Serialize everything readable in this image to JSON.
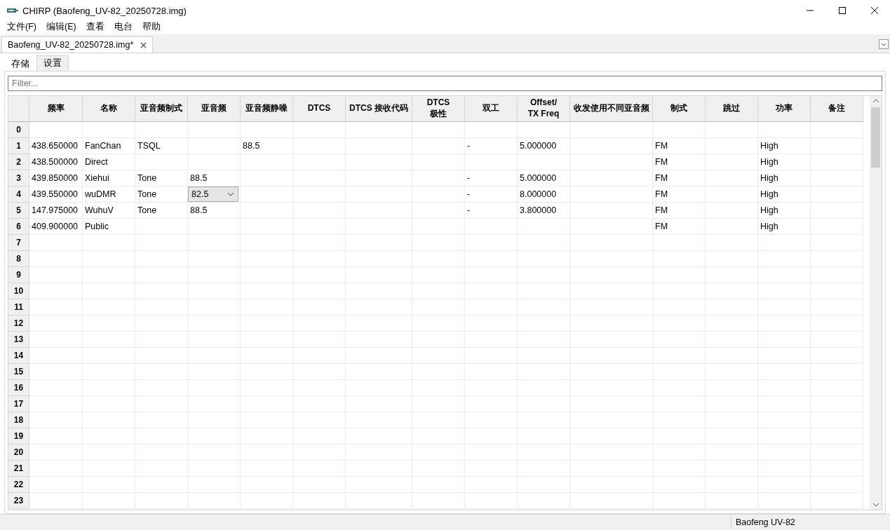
{
  "window": {
    "title": "CHIRP (Baofeng_UV-82_20250728.img)"
  },
  "menu": [
    "文件(F)",
    "编辑(E)",
    "查看",
    "电台",
    "帮助"
  ],
  "document_tabs": [
    {
      "label": "Baofeng_UV-82_20250728.img*",
      "selected": true
    }
  ],
  "tabs": [
    {
      "label": "存储",
      "selected": true
    },
    {
      "label": "设置",
      "selected": false
    }
  ],
  "filter": {
    "placeholder": "Filter..."
  },
  "table": {
    "columns": [
      "频率",
      "名称",
      "亚音频制式",
      "亚音频",
      "亚音频静噪",
      "DTCS",
      "DTCS 接收代码",
      "DTCS\n极性",
      "双工",
      "Offset/\nTX Freq",
      "收发使用不同亚音频",
      "制式",
      "跳过",
      "功率",
      "备注"
    ],
    "rows": [
      {
        "number": "0",
        "cells": [
          null,
          null,
          null,
          null,
          null,
          null,
          null,
          null,
          null,
          null,
          null,
          null,
          null,
          null,
          null
        ]
      },
      {
        "number": "1",
        "cells": [
          "438.650000",
          "FanChan",
          "TSQL",
          null,
          "88.5",
          null,
          null,
          null,
          "-",
          "5.000000",
          null,
          "FM",
          null,
          "High",
          null
        ]
      },
      {
        "number": "2",
        "cells": [
          "438.500000",
          "Direct",
          null,
          null,
          null,
          null,
          null,
          null,
          null,
          null,
          null,
          "FM",
          null,
          "High",
          null
        ]
      },
      {
        "number": "3",
        "cells": [
          "439.850000",
          "Xiehui",
          "Tone",
          "88.5",
          null,
          null,
          null,
          null,
          "-",
          "5.000000",
          null,
          "FM",
          null,
          "High",
          null
        ]
      },
      {
        "number": "4",
        "cells": [
          "439.550000",
          "wuDMR",
          "Tone",
          {
            "kind": "dropdown",
            "value": "82.5"
          },
          null,
          null,
          null,
          null,
          "-",
          "8.000000",
          null,
          "FM",
          null,
          "High",
          null
        ]
      },
      {
        "number": "5",
        "cells": [
          "147.975000",
          "WuhuV",
          "Tone",
          "88.5",
          null,
          null,
          null,
          null,
          "-",
          "3.800000",
          null,
          "FM",
          null,
          "High",
          null
        ]
      },
      {
        "number": "6",
        "cells": [
          "409.900000",
          "Public",
          null,
          null,
          null,
          null,
          null,
          null,
          null,
          null,
          null,
          "FM",
          null,
          "High",
          null
        ]
      },
      {
        "number": "7",
        "cells": []
      },
      {
        "number": "8",
        "cells": []
      },
      {
        "number": "9",
        "cells": []
      },
      {
        "number": "10",
        "cells": []
      },
      {
        "number": "11",
        "cells": []
      },
      {
        "number": "12",
        "cells": []
      },
      {
        "number": "13",
        "cells": []
      },
      {
        "number": "14",
        "cells": []
      },
      {
        "number": "15",
        "cells": []
      },
      {
        "number": "16",
        "cells": []
      },
      {
        "number": "17",
        "cells": []
      },
      {
        "number": "18",
        "cells": []
      },
      {
        "number": "19",
        "cells": []
      },
      {
        "number": "20",
        "cells": []
      },
      {
        "number": "21",
        "cells": []
      },
      {
        "number": "22",
        "cells": []
      },
      {
        "number": "23",
        "cells": []
      }
    ]
  },
  "status_bar": {
    "radio": "Baofeng UV-82"
  }
}
